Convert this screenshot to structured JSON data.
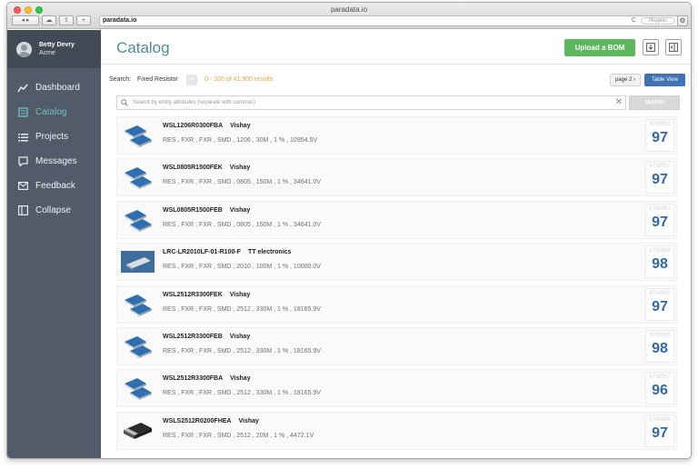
{
  "browser": {
    "title": "paradata.io",
    "url": "paradata.io",
    "search_engine_placeholder": "Яндекс",
    "reload_glyph": "C"
  },
  "sidebar": {
    "user": {
      "name": "Betty Devry",
      "org": "Acme"
    },
    "items": [
      {
        "label": "Dashboard",
        "icon": "chart-line-icon",
        "active": false
      },
      {
        "label": "Catalog",
        "icon": "catalog-book-icon",
        "active": true
      },
      {
        "label": "Projects",
        "icon": "list-icon",
        "active": false
      },
      {
        "label": "Messages",
        "icon": "chat-bubble-icon",
        "active": false
      },
      {
        "label": "Feedback",
        "icon": "envelope-icon",
        "active": false
      },
      {
        "label": "Collapse",
        "icon": "collapse-panel-icon",
        "active": false
      }
    ]
  },
  "header": {
    "title": "Catalog",
    "upload_label": "Upload a BOM"
  },
  "search": {
    "label": "Search:",
    "term": "Fixed Resistor",
    "chip": "×",
    "results": "0 - 100  of  41,900 results",
    "page_label": "page 2 ›",
    "table_view_label": "Table View",
    "filter_placeholder": "Search by entity attributes (separate with commas)",
    "clear_glyph": "✕",
    "button_label": "SEARCH"
  },
  "parts": [
    {
      "part": "WSL1206R0300FBA",
      "mfr": "Vishay",
      "attrs": "RES ,  FXR ,  FXR ,  SMD ,  1206 ,  30M ,  1 % ,  10954.5V",
      "id": "6758951",
      "score": "97",
      "thumb": "smd-blue"
    },
    {
      "part": "WSL0805R1500FEK",
      "mfr": "Vishay",
      "attrs": "RES ,  FXR ,  FXR ,  SMD ,  0805 ,  150M ,  1 % ,  34641.0V",
      "id": "6758957",
      "score": "97",
      "thumb": "smd-blue"
    },
    {
      "part": "WSL0805R1500FEB",
      "mfr": "Vishay",
      "attrs": "RES ,  FXR ,  FXR ,  SMD ,  0805 ,  150M ,  1 % ,  34641.0V",
      "id": "6758953",
      "score": "97",
      "thumb": "smd-blue"
    },
    {
      "part": "LRC-LR2010LF-01-R100-F",
      "mfr": "TT electronics",
      "attrs": "RES ,  FXR ,  FXR ,  SMD ,  2010 ,  100M ,  1 % ,  10000.0V",
      "id": "6758954",
      "score": "98",
      "thumb": "photo-dark"
    },
    {
      "part": "WSL2512R3300FEK",
      "mfr": "Vishay",
      "attrs": "RES ,  FXR ,  FXR ,  SMD ,  2512 ,  330M ,  1 % ,  18165.9V",
      "id": "6758955",
      "score": "97",
      "thumb": "smd-blue"
    },
    {
      "part": "WSL2512R3300FEB",
      "mfr": "Vishay",
      "attrs": "RES ,  FXR ,  FXR ,  SMD ,  2512 ,  330M ,  1 % ,  18165.9V",
      "id": "6758956",
      "score": "98",
      "thumb": "smd-blue"
    },
    {
      "part": "WSL2512R3300FBA",
      "mfr": "Vishay",
      "attrs": "RES ,  FXR ,  FXR ,  SMD ,  2512 ,  330M ,  1 % ,  18165.9V",
      "id": "6758957",
      "score": "96",
      "thumb": "smd-blue"
    },
    {
      "part": "WSLS2512R0200FHEA",
      "mfr": "Vishay",
      "attrs": "RES ,  FXR ,  FXR ,  SMD ,  2512 ,  20M ,  1 % ,  4472.1V",
      "id": "6758958",
      "score": "97",
      "thumb": "chip-black"
    }
  ],
  "colors": {
    "sidebar_bg": "#515b69",
    "accent_teal": "#4c8c99",
    "upload_green": "#5cb85c",
    "table_view_blue": "#3f73b3",
    "score_blue": "#3168a8",
    "results_orange": "#f0a73a"
  }
}
